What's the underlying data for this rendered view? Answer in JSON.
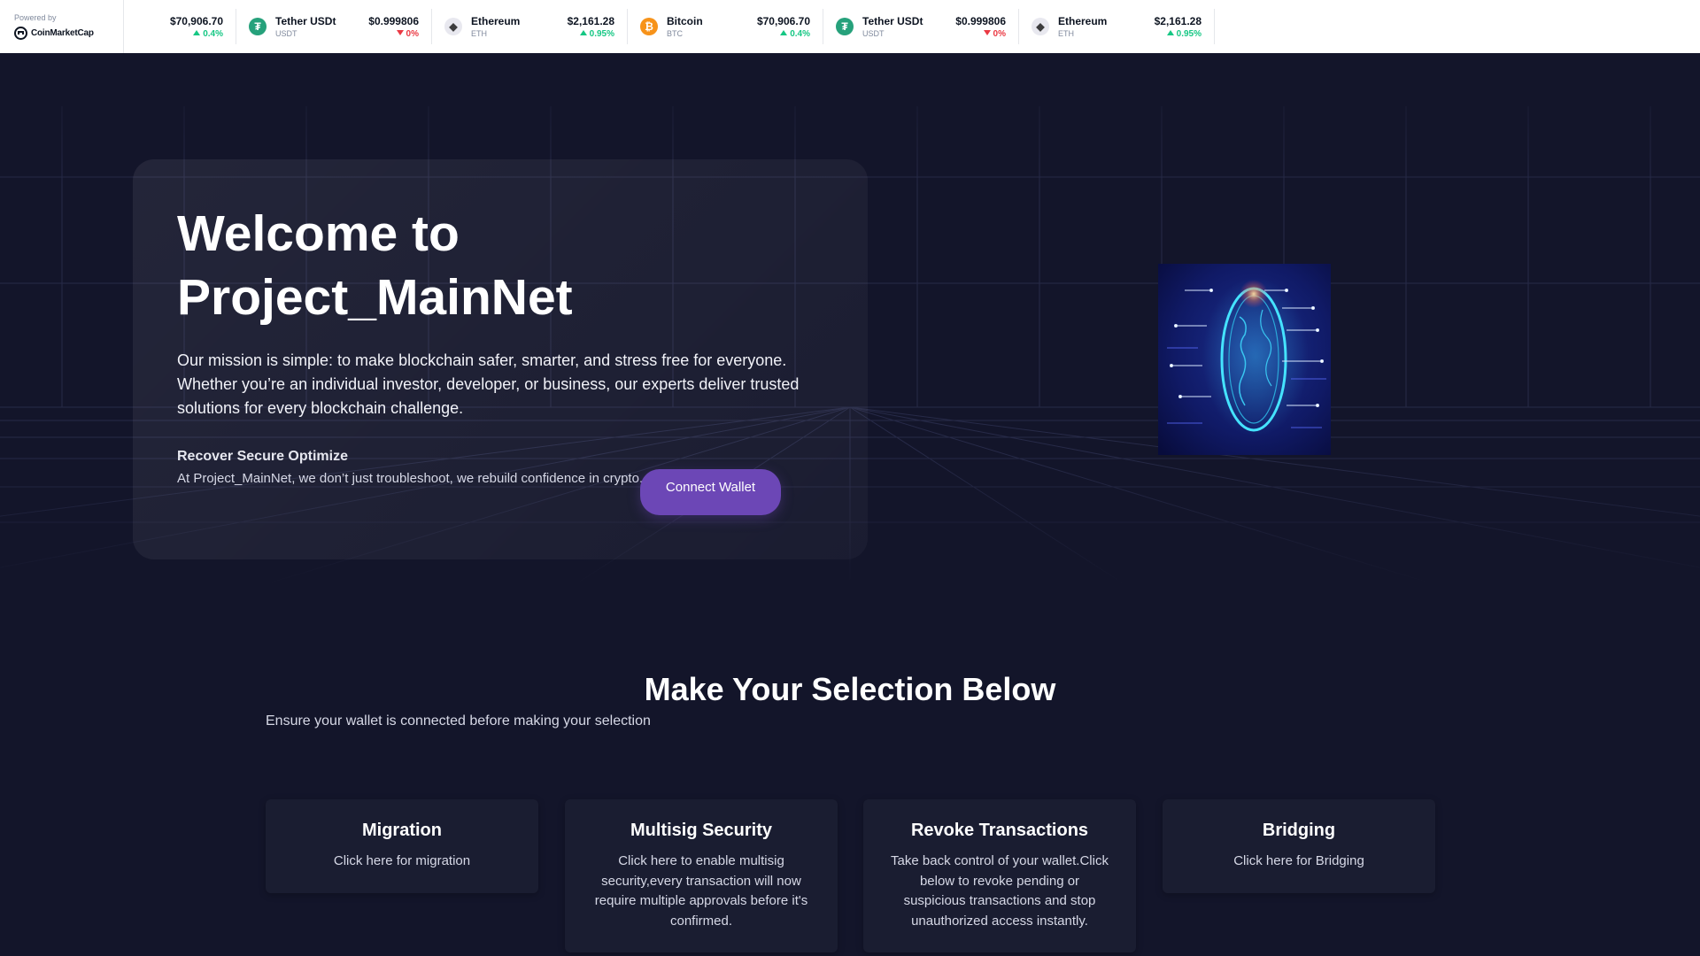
{
  "ticker": {
    "powered_by": "Powered by",
    "brand": "CoinMarketCap",
    "items": [
      {
        "name": "",
        "symbol": "",
        "price": "$70,906.70",
        "change": "0.4%",
        "direction": "up",
        "icon": "bitcoin-icon"
      },
      {
        "name": "Tether USDt",
        "symbol": "USDT",
        "price": "$0.999806",
        "change": "0%",
        "direction": "down",
        "icon": "tether-icon"
      },
      {
        "name": "Ethereum",
        "symbol": "ETH",
        "price": "$2,161.28",
        "change": "0.95%",
        "direction": "up",
        "icon": "ethereum-icon"
      },
      {
        "name": "Bitcoin",
        "symbol": "BTC",
        "price": "$70,906.70",
        "change": "0.4%",
        "direction": "up",
        "icon": "bitcoin-icon"
      },
      {
        "name": "Tether USDt",
        "symbol": "USDT",
        "price": "$0.999806",
        "change": "0%",
        "direction": "down",
        "icon": "tether-icon"
      },
      {
        "name": "Ethereum",
        "symbol": "ETH",
        "price": "$2,161.28",
        "change": "0.95%",
        "direction": "up",
        "icon": "ethereum-icon"
      }
    ],
    "colors": {
      "up": "#16c784",
      "down": "#ea3943",
      "bitcoin": "#f7931a",
      "tether": "#26a17b",
      "ethereum": "#e8e8ef"
    }
  },
  "hero": {
    "title_line1": "Welcome to",
    "title_line2": "Project_MainNet",
    "mission": "Our mission is simple: to make blockchain safer, smarter, and stress free for everyone. Whether you’re an individual investor, developer, or business, our experts deliver trusted solutions for every blockchain challenge.",
    "sub_heading": "Recover Secure Optimize",
    "sub_text": "At Project_MainNet, we don’t just troubleshoot, we rebuild confidence in crypto.",
    "connect_label": "Connect Wallet",
    "accent": "#6c47b6",
    "image": "globe-network-image"
  },
  "selection": {
    "title": "Make Your Selection Below",
    "subtitle": "Ensure your wallet is connected before making your selection",
    "cards": [
      {
        "title": "Migration",
        "text": "Click here for migration"
      },
      {
        "title": "Multisig Security",
        "text": "Click here to enable multisig security,every transaction will now require multiple approvals before it's confirmed."
      },
      {
        "title": "Revoke Transactions",
        "text": "Take back control of your wallet.Click below to revoke pending or suspicious transactions and stop unauthorized access instantly."
      },
      {
        "title": "Bridging",
        "text": "Click here for Bridging"
      }
    ]
  }
}
